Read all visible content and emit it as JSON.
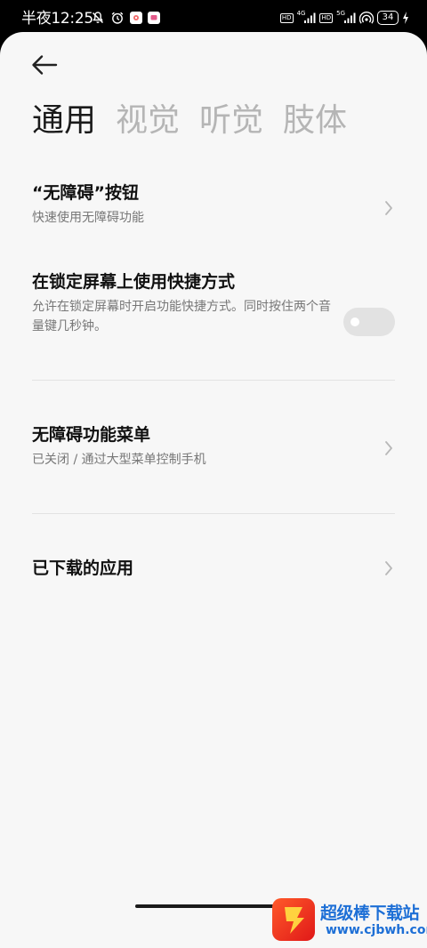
{
  "status_bar": {
    "time": "半夜12:25",
    "hd1": "HD",
    "net1": "4G",
    "hd2": "HD",
    "net2": "5G",
    "battery": "34"
  },
  "header": {
    "back_icon": "arrow-left-icon"
  },
  "tabs": [
    {
      "label": "通用",
      "active": true
    },
    {
      "label": "视觉",
      "active": false
    },
    {
      "label": "听觉",
      "active": false
    },
    {
      "label": "肢体",
      "active": false
    }
  ],
  "items": [
    {
      "title": "“无障碍”按钮",
      "subtitle": "快速使用无障碍功能"
    },
    {
      "title": "在锁定屏幕上使用快捷方式",
      "subtitle": "允许在锁定屏幕时开启功能快捷方式。同时按住两个音量键几秒钟。",
      "toggle_on": false
    },
    {
      "title": "无障碍功能菜单",
      "subtitle": "已关闭 / 通过大型菜单控制手机"
    },
    {
      "title": "已下载的应用"
    }
  ],
  "watermark": {
    "title": "超级棒下载站",
    "url": "www.cjbwh.com"
  },
  "colors": {
    "panel_bg": "#f7f7f7",
    "tab_active": "#1a1a1a",
    "tab_inactive": "#b5b5b5",
    "watermark_blue": "#1d6fd6"
  }
}
